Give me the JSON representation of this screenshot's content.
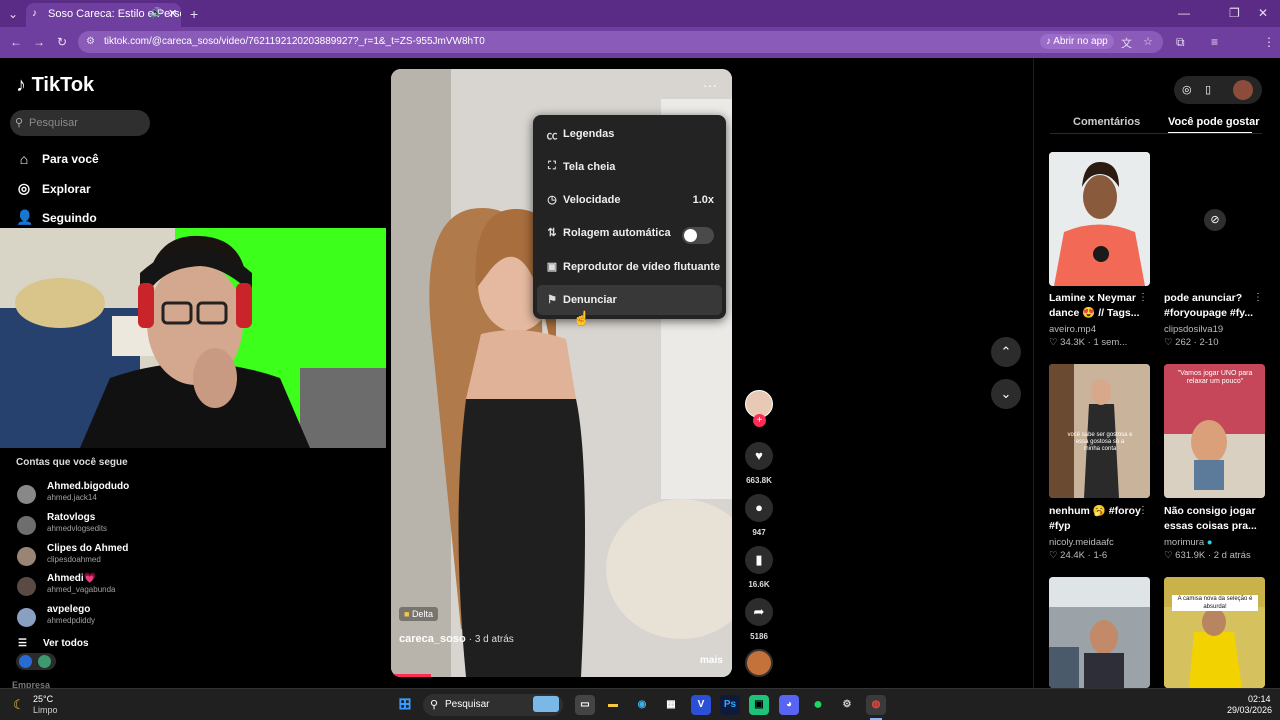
{
  "browser": {
    "tab_title": "Soso Careca: Estilo e Perso...",
    "url": "tiktok.com/@careca_soso/video/7621192120203889927?_r=1&_t=ZS-955JmVW8hT0",
    "open_app": "Abrir no app"
  },
  "sidebar": {
    "logo": "TikTok",
    "search_placeholder": "Pesquisar",
    "nav": [
      {
        "label": "Para você",
        "icon": "home-icon"
      },
      {
        "label": "Explorar",
        "icon": "compass-icon"
      },
      {
        "label": "Seguindo",
        "icon": "user-icon"
      }
    ],
    "following_title": "Contas que você segue",
    "accounts": [
      {
        "name": "Ahmed.bigodudo",
        "handle": "ahmed.jack14"
      },
      {
        "name": "Ratovlogs",
        "handle": "ahmedvlogsedits"
      },
      {
        "name": "Clipes do Ahmed",
        "handle": "clipesdoahmed"
      },
      {
        "name": "Ahmedi💗",
        "handle": "ahmed_vagabunda"
      },
      {
        "name": "avpelego",
        "handle": "ahmedpdiddy"
      }
    ],
    "see_all": "Ver todos",
    "footer_text": "Empresa"
  },
  "video": {
    "badge": "Delta",
    "author": "careca_soso",
    "age": "· 3 d atrás",
    "more": "mais"
  },
  "menu": {
    "items": [
      {
        "label": "Legendas",
        "icon": "captions-icon"
      },
      {
        "label": "Tela cheia",
        "icon": "fullscreen-icon"
      },
      {
        "label": "Velocidade",
        "icon": "speed-icon",
        "value": "1.0x"
      },
      {
        "label": "Rolagem automática",
        "icon": "autoscroll-icon",
        "toggle": false
      },
      {
        "label": "Reprodutor de vídeo flutuante",
        "icon": "float-player-icon"
      },
      {
        "label": "Denunciar",
        "icon": "flag-icon"
      }
    ]
  },
  "actions": {
    "likes": "663.8K",
    "comments": "947",
    "saves": "16.6K",
    "shares": "5186"
  },
  "right_panel": {
    "tabs": [
      "Comentários",
      "Você pode gostar"
    ],
    "active_tab": 1,
    "cards": [
      {
        "title": "Lamine x Neymar dance 😍 // Tags...",
        "user": "aveiro.mp4",
        "likes": "34.3K",
        "age": "1 sem..."
      },
      {
        "title": "pode anunciar? #foryoupage #fy...",
        "user": "clipsdosilva19",
        "likes": "262",
        "age": "2-10"
      },
      {
        "title": "nenhum 🥱 #foroy #fyp",
        "user": "nicoly.meidaafc",
        "likes": "24.4K",
        "age": "1-6"
      },
      {
        "title": "Não consigo jogar essas coisas pra...",
        "user": "morimura",
        "likes": "631.9K",
        "age": "2 d atrás"
      },
      {
        "title": "",
        "user": "",
        "likes": "",
        "age": ""
      },
      {
        "title": "",
        "user": "",
        "likes": "",
        "age": ""
      }
    ],
    "thumb_text_1": "\"Vamos jogar UNO para relaxar um pouco\"",
    "thumb_text_2": "A camisa nova da seleção é absurda!",
    "thumb_text_3": "você sabe ser gostosa e essa gostosa só a minha conta"
  },
  "taskbar": {
    "weather_temp": "25°C",
    "weather_desc": "Limpo",
    "search": "Pesquisar",
    "time": "02:14",
    "date": "29/03/2026"
  }
}
